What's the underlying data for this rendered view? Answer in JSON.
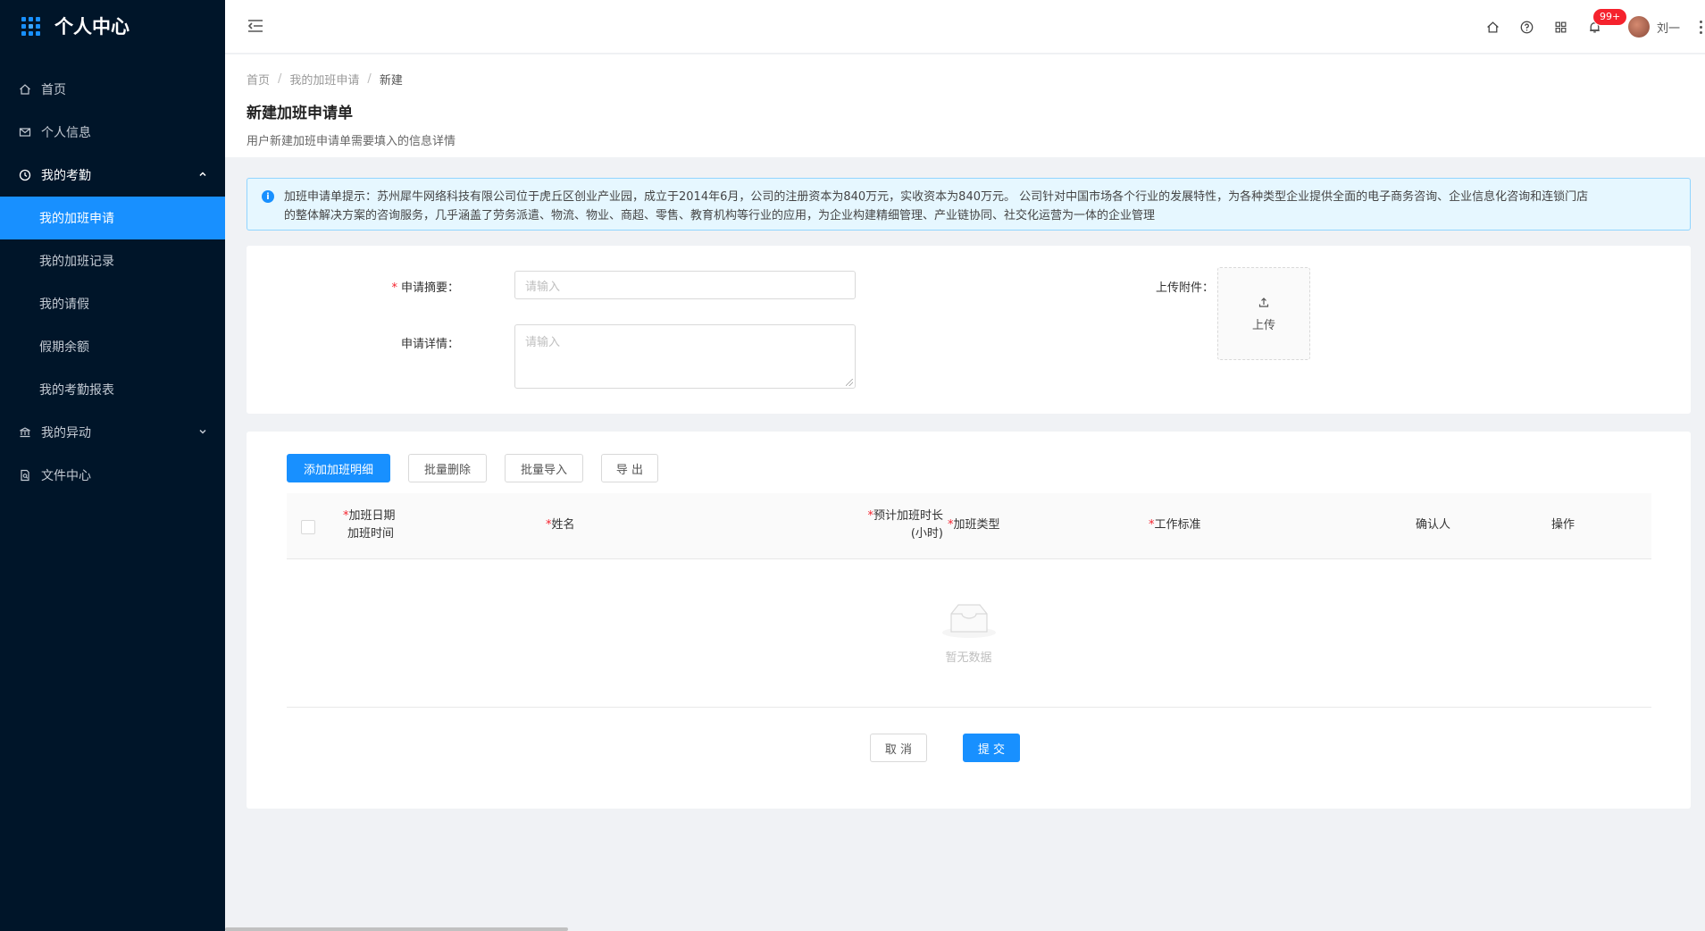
{
  "sidebar": {
    "title": "个人中心",
    "items": [
      {
        "label": "首页"
      },
      {
        "label": "个人信息"
      },
      {
        "label": "我的考勤"
      },
      {
        "label": "我的加班申请"
      },
      {
        "label": "我的加班记录"
      },
      {
        "label": "我的请假"
      },
      {
        "label": "假期余额"
      },
      {
        "label": "我的考勤报表"
      },
      {
        "label": "我的异动"
      },
      {
        "label": "文件中心"
      }
    ]
  },
  "topbar": {
    "notification_count": "99+",
    "user_name": "刘一"
  },
  "breadcrumb": [
    "首页",
    "我的加班申请",
    "新建"
  ],
  "page": {
    "title": "新建加班申请单",
    "description": "用户新建加班申请单需要填入的信息详情"
  },
  "alert": {
    "line1": "加班申请单提示：苏州犀牛网络科技有限公司位于虎丘区创业产业园，成立于2014年6月，公司的注册资本为840万元，实收资本为840万元。 公司针对中国市场各个行业的发展特性，为各种类型企业提供全面的电子商务咨询、企业信息化咨询和连锁门店",
    "line2": "的整体解决方案的咨询服务，几乎涵盖了劳务派遣、物流、物业、商超、零售、教育机构等行业的应用，为企业构建精细管理、产业链协同、社交化运营为一体的企业管理"
  },
  "form": {
    "summary_label": "申请摘要：",
    "summary_placeholder": "请输入",
    "detail_label": "申请详情：",
    "detail_placeholder": "请输入",
    "attachment_label": "上传附件：",
    "upload_label": "上传"
  },
  "toolbar": {
    "add_detail": "添加加班明细",
    "batch_delete": "批量删除",
    "batch_import": "批量导入",
    "export": "导 出"
  },
  "table": {
    "col_date_1": "加班日期",
    "col_date_2": "加班时间",
    "col_name": "姓名",
    "col_hours_1": "预计加班时长",
    "col_hours_2": "(小时)",
    "col_type": "加班类型",
    "col_standard": "工作标准",
    "col_confirmer": "确认人",
    "col_action": "操作",
    "required_mark": "*",
    "empty_text": "暂无数据"
  },
  "footer": {
    "cancel": "取 消",
    "submit": "提 交"
  },
  "colors": {
    "sidebar_bg": "#001529",
    "primary": "#1890ff",
    "danger": "#f5222d",
    "alert_bg": "#e6f7ff"
  }
}
